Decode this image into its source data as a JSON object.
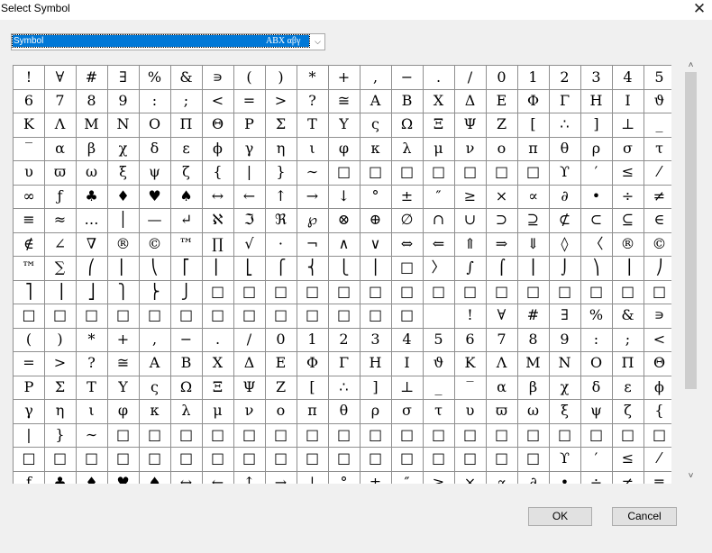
{
  "window": {
    "title": "Select Symbol",
    "close_glyph": "✕"
  },
  "font_select": {
    "value": "Symbol",
    "sample": "ABX αβγ",
    "arrow": "⌵"
  },
  "grid": {
    "columns": 21,
    "rows": [
      [
        "!",
        "∀",
        "#",
        "∃",
        "%",
        "&",
        "∍",
        "(",
        ")",
        "*",
        "+",
        ",",
        "−",
        ".",
        "/",
        "0",
        "1",
        "2",
        "3",
        "4",
        "5"
      ],
      [
        "6",
        "7",
        "8",
        "9",
        ":",
        ";",
        "<",
        "=",
        ">",
        "?",
        "≅",
        "Α",
        "Β",
        "Χ",
        "Δ",
        "Ε",
        "Φ",
        "Γ",
        "Η",
        "Ι",
        "ϑ"
      ],
      [
        "Κ",
        "Λ",
        "Μ",
        "Ν",
        "Ο",
        "Π",
        "Θ",
        "Ρ",
        "Σ",
        "Τ",
        "Υ",
        "ς",
        "Ω",
        "Ξ",
        "Ψ",
        "Ζ",
        "[",
        "∴",
        "]",
        "⊥",
        "_"
      ],
      [
        "‾",
        "α",
        "β",
        "χ",
        "δ",
        "ε",
        "ϕ",
        "γ",
        "η",
        "ι",
        "φ",
        "κ",
        "λ",
        "μ",
        "ν",
        "ο",
        "π",
        "θ",
        "ρ",
        "σ",
        "τ"
      ],
      [
        "υ",
        "ϖ",
        "ω",
        "ξ",
        "ψ",
        "ζ",
        "{",
        "|",
        "}",
        "∼",
        "□",
        "□",
        "□",
        "□",
        "□",
        "□",
        "□",
        "ϒ",
        "′",
        "≤",
        "⁄"
      ],
      [
        "∞",
        "ƒ",
        "♣",
        "♦",
        "♥",
        "♠",
        "↔",
        "←",
        "↑",
        "→",
        "↓",
        "°",
        "±",
        "″",
        "≥",
        "×",
        "∝",
        "∂",
        "•",
        "÷",
        "≠"
      ],
      [
        "≡",
        "≈",
        "…",
        "│",
        "—",
        "↵",
        "ℵ",
        "ℑ",
        "ℜ",
        "℘",
        "⊗",
        "⊕",
        "∅",
        "∩",
        "∪",
        "⊃",
        "⊇",
        "⊄",
        "⊂",
        "⊆",
        "∈"
      ],
      [
        "∉",
        "∠",
        "∇",
        "®",
        "©",
        "™",
        "∏",
        "√",
        "⋅",
        "¬",
        "∧",
        "∨",
        "⇔",
        "⇐",
        "⇑",
        "⇒",
        "⇓",
        "◊",
        "〈",
        "®",
        "©"
      ],
      [
        "™",
        "∑",
        "⎛",
        "⎜",
        "⎝",
        "⎡",
        "⎢",
        "⎣",
        "⎧",
        "⎨",
        "⎩",
        "⎪",
        "□",
        "〉",
        "∫",
        "⌠",
        "⎮",
        "⌡",
        "⎞",
        "⎟",
        "⎠"
      ],
      [
        "⎤",
        "⎥",
        "⎦",
        "⎫",
        "⎬",
        "⎭",
        "□",
        "□",
        "□",
        "□",
        "□",
        "□",
        "□",
        "□",
        "□",
        "□",
        "□",
        "□",
        "□",
        "□",
        "□"
      ],
      [
        "□",
        "□",
        "□",
        "□",
        "□",
        "□",
        "□",
        "□",
        "□",
        "□",
        "□",
        "□",
        "□",
        "",
        "!",
        "∀",
        "#",
        "∃",
        "%",
        "&",
        "∍"
      ],
      [
        "(",
        ")",
        "*",
        "+",
        ",",
        "−",
        ".",
        "/",
        "0",
        "1",
        "2",
        "3",
        "4",
        "5",
        "6",
        "7",
        "8",
        "9",
        ":",
        ";",
        "<"
      ],
      [
        "=",
        ">",
        "?",
        "≅",
        "Α",
        "Β",
        "Χ",
        "Δ",
        "Ε",
        "Φ",
        "Γ",
        "Η",
        "Ι",
        "ϑ",
        "Κ",
        "Λ",
        "Μ",
        "Ν",
        "Ο",
        "Π",
        "Θ"
      ],
      [
        "Ρ",
        "Σ",
        "Τ",
        "Υ",
        "ς",
        "Ω",
        "Ξ",
        "Ψ",
        "Ζ",
        "[",
        "∴",
        "]",
        "⊥",
        "_",
        "‾",
        "α",
        "β",
        "χ",
        "δ",
        "ε",
        "ϕ"
      ],
      [
        "γ",
        "η",
        "ι",
        "φ",
        "κ",
        "λ",
        "μ",
        "ν",
        "ο",
        "π",
        "θ",
        "ρ",
        "σ",
        "τ",
        "υ",
        "ϖ",
        "ω",
        "ξ",
        "ψ",
        "ζ",
        "{"
      ],
      [
        "|",
        "}",
        "∼",
        "□",
        "□",
        "□",
        "□",
        "□",
        "□",
        "□",
        "□",
        "□",
        "□",
        "□",
        "□",
        "□",
        "□",
        "□",
        "□",
        "□",
        "□"
      ],
      [
        "□",
        "□",
        "□",
        "□",
        "□",
        "□",
        "□",
        "□",
        "□",
        "□",
        "□",
        "□",
        "□",
        "□",
        "□",
        "□",
        "□",
        "ϒ",
        "′",
        "≤",
        "⁄",
        "∞"
      ],
      [
        "ƒ",
        "♣",
        "♦",
        "♥",
        "♠",
        "↔",
        "←",
        "↑",
        "→",
        "↓",
        "°",
        "±",
        "″",
        "≥",
        "×",
        "∝",
        "∂",
        "•",
        "÷",
        "≠",
        "≡"
      ]
    ]
  },
  "scrollbar": {
    "up_glyph": "˄",
    "down_glyph": "˅",
    "position": 0.0
  },
  "buttons": {
    "ok": "OK",
    "cancel": "Cancel"
  }
}
